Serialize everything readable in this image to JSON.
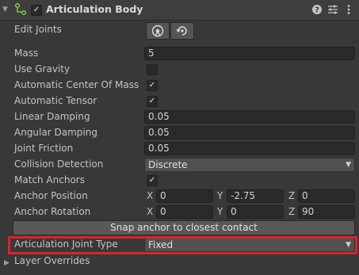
{
  "header": {
    "title": "Articulation Body",
    "enabled": true,
    "help_icon": "help-icon",
    "settings_icon": "sliders-icon",
    "menu_icon": "kebab-menu-icon"
  },
  "edit_joints": {
    "label": "Edit Joints"
  },
  "fields": {
    "mass": {
      "label": "Mass",
      "value": "5"
    },
    "use_gravity": {
      "label": "Use Gravity",
      "checked": false
    },
    "auto_center_of_mass": {
      "label": "Automatic Center Of Mass",
      "checked": true
    },
    "auto_tensor": {
      "label": "Automatic Tensor",
      "checked": true
    },
    "linear_damping": {
      "label": "Linear Damping",
      "value": "0.05"
    },
    "angular_damping": {
      "label": "Angular Damping",
      "value": "0.05"
    },
    "joint_friction": {
      "label": "Joint Friction",
      "value": "0.05"
    },
    "collision_detection": {
      "label": "Collision Detection",
      "value": "Discrete"
    },
    "match_anchors": {
      "label": "Match Anchors",
      "checked": true
    },
    "anchor_position": {
      "label": "Anchor Position",
      "x": "0",
      "y": "-2.75",
      "z": "0"
    },
    "anchor_rotation": {
      "label": "Anchor Rotation",
      "x": "0",
      "y": "0",
      "z": "90"
    },
    "joint_type": {
      "label": "Articulation Joint Type",
      "value": "Fixed"
    }
  },
  "axes": {
    "x": "X",
    "y": "Y",
    "z": "Z"
  },
  "snap_button": "Snap anchor to closest contact",
  "layer_overrides": "Layer Overrides",
  "colors": {
    "highlight": "#e0202a",
    "background": "#383838"
  },
  "glyphs": {
    "check": "✓",
    "caret": "▼",
    "arrow_down": "▼",
    "arrow_right": "▶"
  }
}
